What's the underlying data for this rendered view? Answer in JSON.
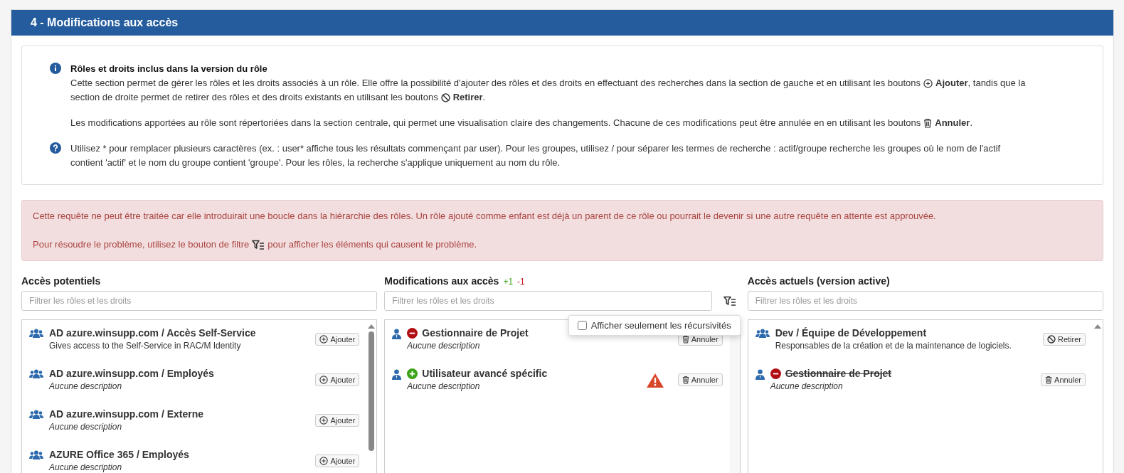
{
  "section": {
    "title": "4 - Modifications aux accès"
  },
  "info": {
    "heading": "Rôles et droits inclus dans la version du rôle",
    "paragraphs": [
      {
        "kind": "info",
        "lines": [
          [
            "Cette section permet de gérer les rôles et les droits associés à un rôle. Elle offre la possibilité d'ajouter des rôles et des droits en effectuant des recherches dans la section de gauche et en utilisant les boutons",
            "**Ajouter**, tandis que la"
          ],
          [
            "section de droite permet de retirer des rôles et des droits existants en utilisant les boutons",
            "**Retirer**."
          ]
        ]
      },
      {
        "kind": "plain",
        "lines": [
          [
            "Les modifications apportées au rôle sont répertoriées dans la section centrale, qui permet une visualisation claire des changements. Chacune de ces modifications peut être annulée en en utilisant les boutons",
            "**Annuler**."
          ]
        ]
      },
      {
        "kind": "help",
        "lines": [
          [
            "Utilisez * pour remplacer plusieurs caractères (ex. : user* affiche tous les résultats commençant par user). Pour les groupes, utilisez / pour séparer les termes de recherche : actif/groupe recherche les groupes où le nom de l'actif"
          ],
          [
            "contient 'actif' et le nom du groupe contient 'groupe'. Pour les rôles, la recherche s'applique uniquement au nom du rôle."
          ]
        ]
      }
    ]
  },
  "alert": {
    "paragraphs": [
      {
        "lines": [
          [
            "Cette requête ne peut être traitée car elle introduirait une boucle dans la hiérarchie des rôles. Un rôle ajouté comme enfant est déjà un parent de ce rôle ou pourrait le devenir si une autre requête en attente est approuvée."
          ]
        ]
      },
      {
        "lines": [
          [
            "Pour résoudre le problème, utilisez le bouton de filtre",
            "pour afficher les éléments qui causent le problème."
          ]
        ]
      }
    ]
  },
  "columns": [
    {
      "kind": "potential",
      "title": "Accès potentiels",
      "placeholder": "Filtrer les rôles et les droits",
      "items": [
        {
          "kind": "group",
          "added": false,
          "removed": false,
          "name": "AD azure.winsupp.com / Accès Self-Service",
          "description": "Gives access to the Self-Service in RAC/M Identity",
          "description_missing": false,
          "struck": false,
          "button": {
            "kind": "add",
            "label": "Ajouter"
          }
        },
        {
          "kind": "group",
          "added": false,
          "removed": false,
          "name": "AD azure.winsupp.com / Employés",
          "description": "Aucune description",
          "description_missing": true,
          "struck": false,
          "button": {
            "kind": "add",
            "label": "Ajouter"
          }
        },
        {
          "kind": "group",
          "added": false,
          "removed": false,
          "name": "AD azure.winsupp.com / Externe",
          "description": "Aucune description",
          "description_missing": true,
          "struck": false,
          "button": {
            "kind": "add",
            "label": "Ajouter"
          }
        },
        {
          "kind": "group",
          "added": false,
          "removed": false,
          "name": "AZURE Office 365 / Employés",
          "description": "Aucune description",
          "description_missing": true,
          "struck": false,
          "button": {
            "kind": "add",
            "label": "Ajouter"
          }
        }
      ]
    },
    {
      "kind": "changes",
      "title": "Modifications aux accès",
      "added_count": "+1",
      "removed_count": "-1",
      "placeholder": "Filtrer les rôles et les droits",
      "filter_menu": {
        "open": true,
        "label": "Afficher seulement les récursivités",
        "checked": false
      },
      "items": [
        {
          "kind": "user",
          "added": false,
          "removed": true,
          "name": "Gestionnaire de Projet",
          "description": "Aucune description",
          "description_missing": true,
          "struck": false,
          "button": {
            "kind": "cancel",
            "label": "Annuler"
          }
        },
        {
          "kind": "user",
          "added": true,
          "removed": false,
          "name": "Utilisateur avancé spécific",
          "description": "Aucune description",
          "description_missing": true,
          "struck": false,
          "warning": true,
          "button": {
            "kind": "cancel",
            "label": "Annuler"
          }
        }
      ]
    },
    {
      "kind": "current",
      "title": "Accès actuels (version active)",
      "placeholder": "Filtrer les rôles et les droits",
      "items": [
        {
          "kind": "group",
          "added": false,
          "removed": false,
          "name": "Dev / Équipe de Développement",
          "description": "Responsables de la création et de la maintenance de logiciels.",
          "description_missing": false,
          "struck": false,
          "button": {
            "kind": "remove",
            "label": "Retirer"
          }
        },
        {
          "kind": "user",
          "added": false,
          "removed": true,
          "name": "Gestionnaire de Projet",
          "description": "Aucune description",
          "description_missing": true,
          "struck": true,
          "button": {
            "kind": "cancel",
            "label": "Annuler"
          }
        }
      ]
    }
  ]
}
